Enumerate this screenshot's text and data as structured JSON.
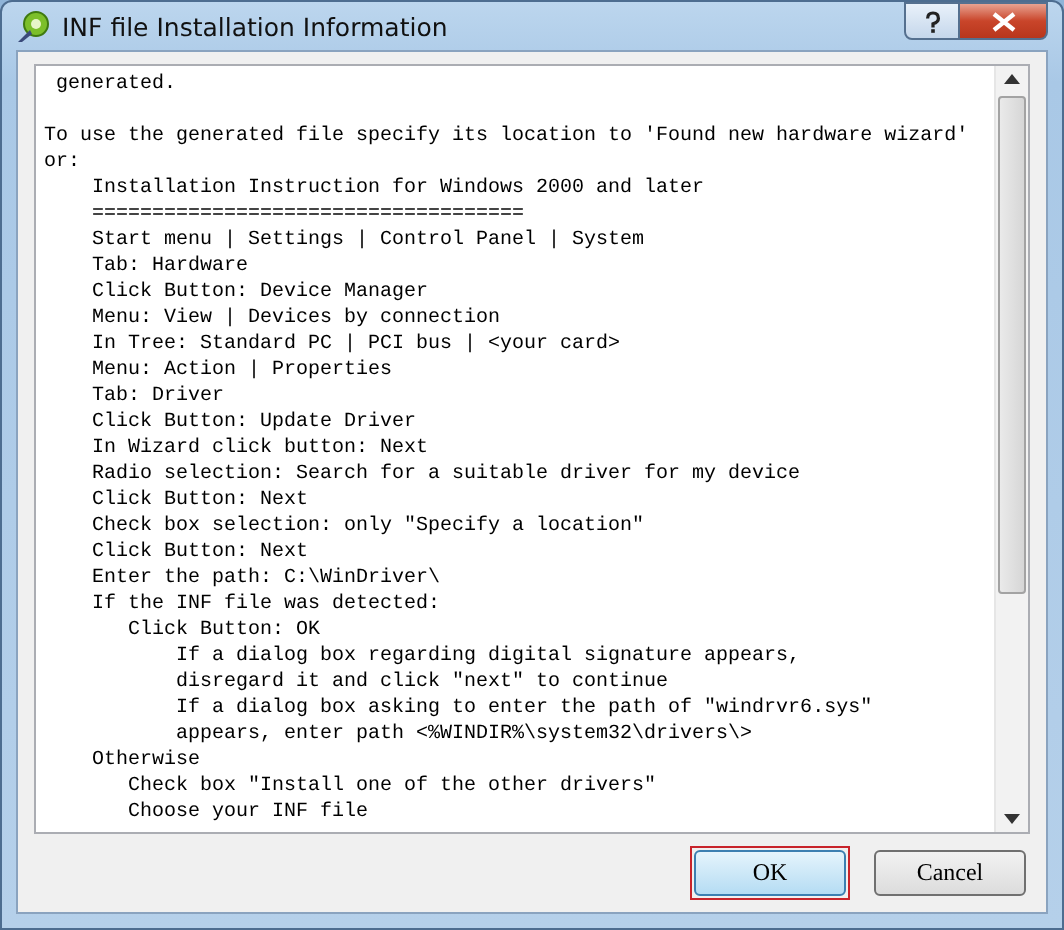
{
  "window": {
    "title": "INF file Installation Information"
  },
  "text": {
    "paragraphs": [
      [
        " generated."
      ],
      [
        "To use the generated file specify its location to 'Found new hardware wizard'",
        "or:",
        "    Installation Instruction for Windows 2000 and later",
        "    ====================================",
        "    Start menu | Settings | Control Panel | System",
        "    Tab: Hardware",
        "    Click Button: Device Manager",
        "    Menu: View | Devices by connection",
        "    In Tree: Standard PC | PCI bus | <your card>",
        "    Menu: Action | Properties",
        "    Tab: Driver",
        "    Click Button: Update Driver",
        "    In Wizard click button: Next",
        "    Radio selection: Search for a suitable driver for my device",
        "    Click Button: Next",
        "    Check box selection: only \"Specify a location\"",
        "    Click Button: Next",
        "    Enter the path: C:\\WinDriver\\",
        "    If the INF file was detected:",
        "       Click Button: OK",
        "           If a dialog box regarding digital signature appears,",
        "           disregard it and click \"next\" to continue",
        "           If a dialog box asking to enter the path of \"windrvr6.sys\"",
        "           appears, enter path <%WINDIR%\\system32\\drivers\\>",
        "    Otherwise",
        "       Check box \"Install one of the other drivers\"",
        "       Choose your INF file"
      ]
    ]
  },
  "buttons": [
    {
      "label": "OK",
      "highlighted": true
    },
    {
      "label": "Cancel",
      "highlighted": false
    }
  ]
}
